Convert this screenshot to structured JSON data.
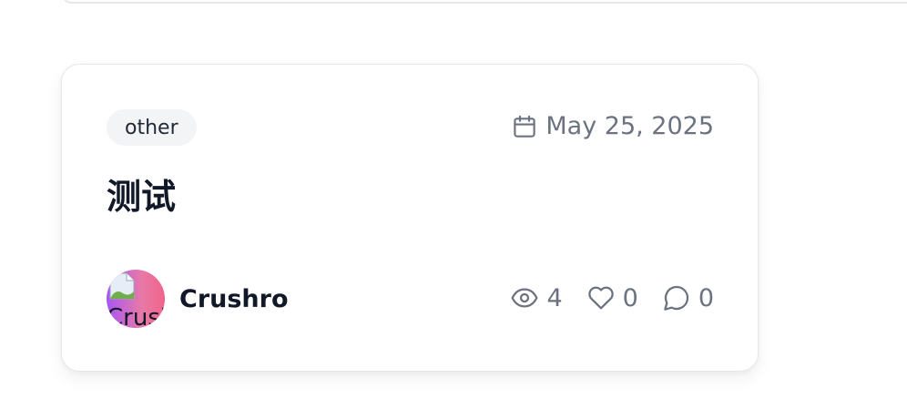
{
  "post": {
    "category": "other",
    "date": "May 25, 2025",
    "title": "测试",
    "author": {
      "name": "Crushro",
      "avatar_alt": "Crushro"
    },
    "stats": {
      "views": "4",
      "likes": "0",
      "comments": "0"
    }
  },
  "icons": {
    "date": "calendar-icon",
    "views": "eye-icon",
    "likes": "heart-icon",
    "comments": "comment-icon"
  },
  "colors": {
    "muted": "#6b7280",
    "tag_bg": "#f3f4f6",
    "avatar_gradient_start": "#a855f7",
    "avatar_gradient_end": "#f0648a"
  }
}
